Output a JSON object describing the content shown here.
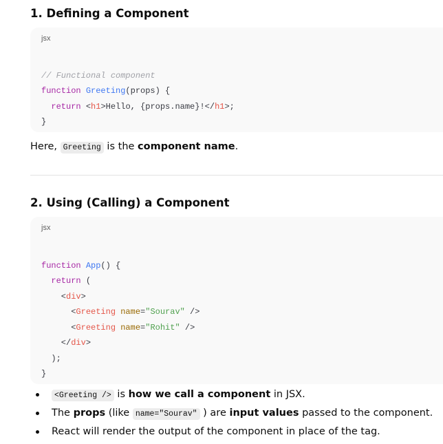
{
  "section1": {
    "heading": "1. Defining a Component",
    "code_lang": "jsx",
    "code": [
      [],
      [
        [
          "// Functional component",
          "cm"
        ]
      ],
      [
        [
          "function ",
          "kw"
        ],
        [
          "Greeting",
          "fn"
        ],
        [
          "(props) {",
          "pl"
        ]
      ],
      [
        [
          "  ",
          "pl"
        ],
        [
          "return ",
          "kw"
        ],
        [
          "<",
          "pl"
        ],
        [
          "h1",
          "tag"
        ],
        [
          ">Hello, {props.name}!</",
          "pl"
        ],
        [
          "h1",
          "tag"
        ],
        [
          ">;",
          "pl"
        ]
      ],
      [
        [
          "}",
          "pl"
        ]
      ]
    ],
    "note_prefix": "Here, ",
    "note_code": "Greeting",
    "note_mid": " is the ",
    "note_bold": "component name",
    "note_suffix": "."
  },
  "section2": {
    "heading": "2. Using (Calling) a Component",
    "code_lang": "jsx",
    "code": [
      [],
      [
        [
          "function ",
          "kw"
        ],
        [
          "App",
          "fn"
        ],
        [
          "() {",
          "pl"
        ]
      ],
      [
        [
          "  ",
          "pl"
        ],
        [
          "return ",
          "kw"
        ],
        [
          "(",
          "pl"
        ]
      ],
      [
        [
          "    <",
          "pl"
        ],
        [
          "div",
          "tag"
        ],
        [
          ">",
          "pl"
        ]
      ],
      [
        [
          "      <",
          "pl"
        ],
        [
          "Greeting",
          "tag"
        ],
        [
          " ",
          "pl"
        ],
        [
          "name",
          "attr"
        ],
        [
          "=",
          "pl"
        ],
        [
          "\"Sourav\"",
          "str"
        ],
        [
          " />",
          "pl"
        ]
      ],
      [
        [
          "      <",
          "pl"
        ],
        [
          "Greeting",
          "tag"
        ],
        [
          " ",
          "pl"
        ],
        [
          "name",
          "attr"
        ],
        [
          "=",
          "pl"
        ],
        [
          "\"Rohit\"",
          "str"
        ],
        [
          " />",
          "pl"
        ]
      ],
      [
        [
          "    </",
          "pl"
        ],
        [
          "div",
          "tag"
        ],
        [
          ">",
          "pl"
        ]
      ],
      [
        [
          "  );",
          "pl"
        ]
      ],
      [
        [
          "}",
          "pl"
        ]
      ]
    ]
  },
  "bullets": [
    {
      "code": "<Greeting />",
      "t1": " is ",
      "b1": "how we call a component",
      "t2": " in JSX."
    },
    {
      "t0": "The ",
      "b0": "props",
      "t1": " (like ",
      "code": "name=\"Sourav\"",
      "t2": " ) are ",
      "b1": "input values",
      "t3": " passed to the component."
    },
    {
      "t0": "React will render the output of the component in place of the tag."
    }
  ]
}
